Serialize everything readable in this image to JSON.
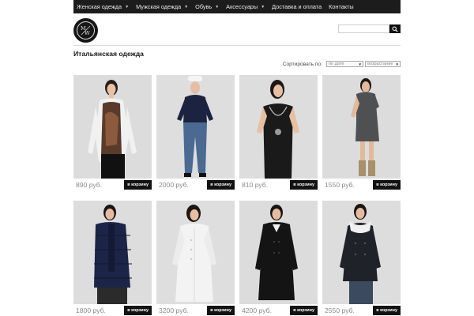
{
  "nav": {
    "items": [
      {
        "label": "Женская одежда",
        "has_dropdown": true
      },
      {
        "label": "Мужская одежда",
        "has_dropdown": true
      },
      {
        "label": "Обувь",
        "has_dropdown": true
      },
      {
        "label": "Аксессуары",
        "has_dropdown": true
      },
      {
        "label": "Доставка и оплата",
        "has_dropdown": false
      },
      {
        "label": "Контакты",
        "has_dropdown": false
      }
    ],
    "dropdown_glyph": "▼"
  },
  "search": {
    "value": "",
    "icon": "search-icon"
  },
  "page_title": "Итальянская одежда",
  "sort": {
    "label": "Сортировать по:",
    "field_selected": "по дате",
    "order_selected": "возрастание"
  },
  "products": [
    {
      "price": "890 руб.",
      "button": "в корзину",
      "outfit": "printed-top-black-skirt"
    },
    {
      "price": "2000 руб.",
      "button": "в корзину",
      "outfit": "navy-sweater-jeans-cap"
    },
    {
      "price": "810 руб.",
      "button": "в корзину",
      "outfit": "black-top-necklace"
    },
    {
      "price": "1550 руб.",
      "button": "в корзину",
      "outfit": "grey-dress-boots"
    },
    {
      "price": "1800 руб.",
      "button": "в корзину",
      "outfit": "navy-puffer-jacket"
    },
    {
      "price": "3200 руб.",
      "button": "в корзину",
      "outfit": "white-coat"
    },
    {
      "price": "4200 руб.",
      "button": "в корзину",
      "outfit": "black-coat"
    },
    {
      "price": "2550 руб.",
      "button": "в корзину",
      "outfit": "black-peacoat-fur-collar"
    }
  ],
  "colors": {
    "nav_bg": "#1c1c1c",
    "button_bg": "#121212",
    "photo_bg": "#dddddd",
    "price_text": "#8a8a8a"
  }
}
